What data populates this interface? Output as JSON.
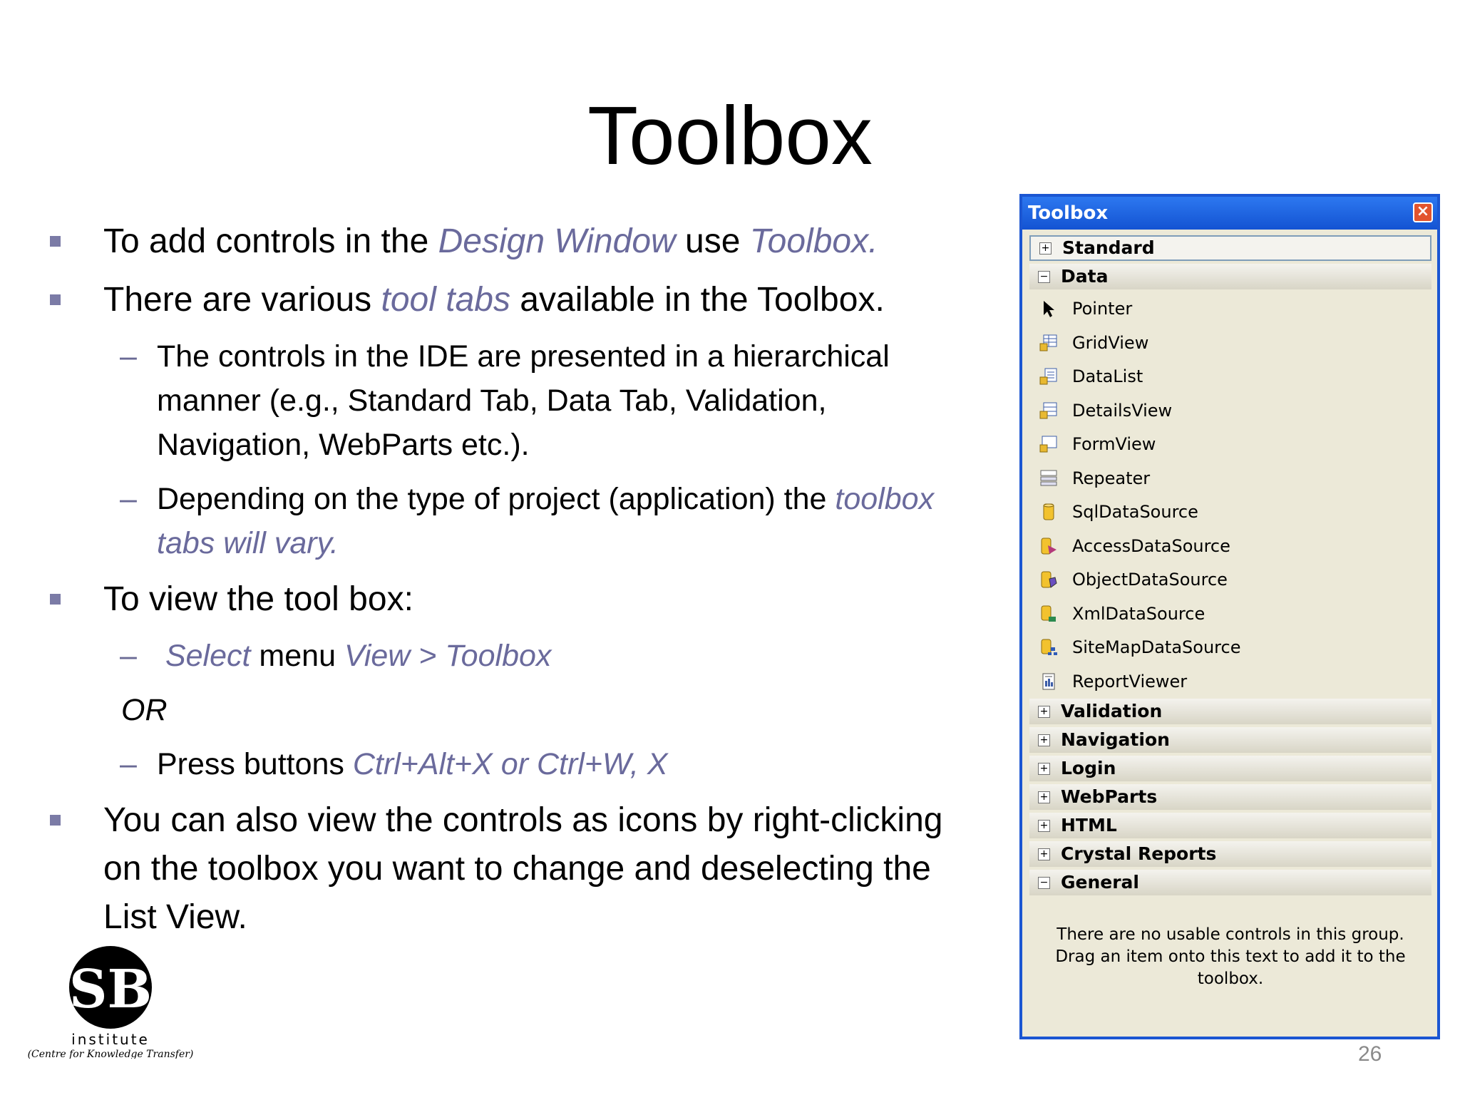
{
  "slide": {
    "title": "Toolbox",
    "page_number": "26"
  },
  "bullets": {
    "b1": {
      "t1": "To add controls in the ",
      "e1": "Design Window",
      "t2": " use ",
      "e2": "Toolbox."
    },
    "b2": {
      "t1": "There are various ",
      "e1": "tool tabs",
      "t2": " available in the Toolbox."
    },
    "b2_sub1": {
      "t1": "The controls in the IDE are presented in a hierarchical manner (e.g., Standard Tab, Data Tab, Validation, Navigation, WebParts etc.)."
    },
    "b2_sub2": {
      "t1": "Depending on the type of project (application) the ",
      "e1": "toolbox tabs will vary."
    },
    "b3": {
      "t1": "To view the tool box:"
    },
    "b3_sub1": {
      "e1": "Select",
      "t1": " menu ",
      "e2": "View > Toolbox"
    },
    "or": "OR",
    "b3_sub2": {
      "t1": "Press buttons ",
      "e1": "Ctrl+Alt+X or Ctrl+W, X"
    },
    "b4": {
      "t1": "You can also view the controls as icons by right-clicking on the toolbox you want to change and deselecting the List View."
    }
  },
  "logo": {
    "mark": "SB",
    "name": "institute",
    "tagline": "(Centre for Knowledge Transfer)"
  },
  "toolbox": {
    "title": "Toolbox",
    "close_glyph": "×",
    "tabs_top": [
      {
        "label": "Standard",
        "state": "+"
      },
      {
        "label": "Data",
        "state": "−"
      }
    ],
    "data_items": [
      {
        "label": "Pointer",
        "icon": "pointer-icon"
      },
      {
        "label": "GridView",
        "icon": "gridview-icon"
      },
      {
        "label": "DataList",
        "icon": "datalist-icon"
      },
      {
        "label": "DetailsView",
        "icon": "detailsview-icon"
      },
      {
        "label": "FormView",
        "icon": "formview-icon"
      },
      {
        "label": "Repeater",
        "icon": "repeater-icon"
      },
      {
        "label": "SqlDataSource",
        "icon": "sqldatasource-icon"
      },
      {
        "label": "AccessDataSource",
        "icon": "accessdatasource-icon"
      },
      {
        "label": "ObjectDataSource",
        "icon": "objectdatasource-icon"
      },
      {
        "label": "XmlDataSource",
        "icon": "xmldatasource-icon"
      },
      {
        "label": "SiteMapDataSource",
        "icon": "sitemapdatasource-icon"
      },
      {
        "label": "ReportViewer",
        "icon": "reportviewer-icon"
      }
    ],
    "tabs_bottom": [
      {
        "label": "Validation",
        "state": "+"
      },
      {
        "label": "Navigation",
        "state": "+"
      },
      {
        "label": "Login",
        "state": "+"
      },
      {
        "label": "WebParts",
        "state": "+"
      },
      {
        "label": "HTML",
        "state": "+"
      },
      {
        "label": "Crystal Reports",
        "state": "+"
      },
      {
        "label": "General",
        "state": "−"
      }
    ],
    "general_note": "There are no usable controls in this group. Drag an item onto this text to add it to the toolbox."
  },
  "colors": {
    "emphasis": "#6a6a9c",
    "bullet": "#7b7ba6",
    "toolbox_title": "#1353d2",
    "toolbox_bg": "#ece9d8"
  }
}
